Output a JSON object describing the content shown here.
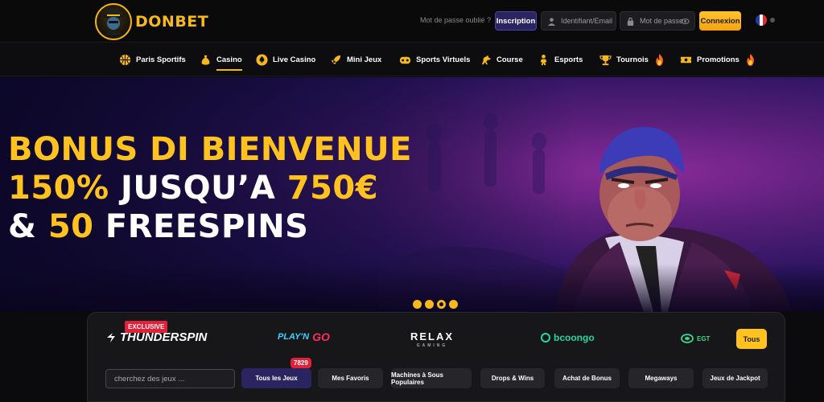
{
  "brand": {
    "name": "DONBET",
    "accent": "#f6b81b"
  },
  "header": {
    "forgot_password": "Mot de passe oublié ?",
    "signup_label": "Inscription",
    "username_placeholder": "Identifiant/Email",
    "password_placeholder": "Mot de passe",
    "login_label": "Connexion",
    "language": "fr-flag-icon"
  },
  "nav": {
    "items": [
      {
        "label": "Paris Sportifs",
        "icon": "basketball-icon"
      },
      {
        "label": "Casino",
        "icon": "money-bag-icon",
        "active": true
      },
      {
        "label": "Live Casino",
        "icon": "spade-icon"
      },
      {
        "label": "Mini Jeux",
        "icon": "rocket-icon"
      },
      {
        "label": "Sports Virtuels",
        "icon": "gamepad-icon"
      },
      {
        "label": "Course",
        "icon": "horse-icon"
      },
      {
        "label": "Esports",
        "icon": "soldier-icon"
      },
      {
        "label": "Tournois",
        "icon": "trophy-icon",
        "hot": true
      },
      {
        "label": "Promotions",
        "icon": "ticket-icon",
        "hot": true
      }
    ]
  },
  "hero": {
    "line1": "BONUS DI BIENVENUE",
    "line2_a": "150%",
    "line2_b": " JUSQU’A ",
    "line2_c": "750€",
    "line3_a": "& ",
    "line3_b": "50",
    "line3_c": " FREESPINS",
    "slides": 4,
    "active_slide": 3
  },
  "providers": {
    "exclusive_badge": "EXCLUSIVE",
    "items": [
      "THUNDERSPIN",
      "PLAY'N GO",
      "RELAX",
      "bcoongo",
      "EGT"
    ],
    "relax_sub": "GAMING",
    "playngo_a": "PLAY'N",
    "playngo_b": "GO",
    "all_label": "Tous"
  },
  "games": {
    "search_placeholder": "cherchez des jeux ...",
    "total_count": "7829",
    "categories": [
      "Tous les Jeux",
      "Mes Favoris",
      "Machines à Sous Populaires",
      "Drops & Wins",
      "Achat de Bonus",
      "Megaways",
      "Jeux de Jackpot"
    ]
  }
}
